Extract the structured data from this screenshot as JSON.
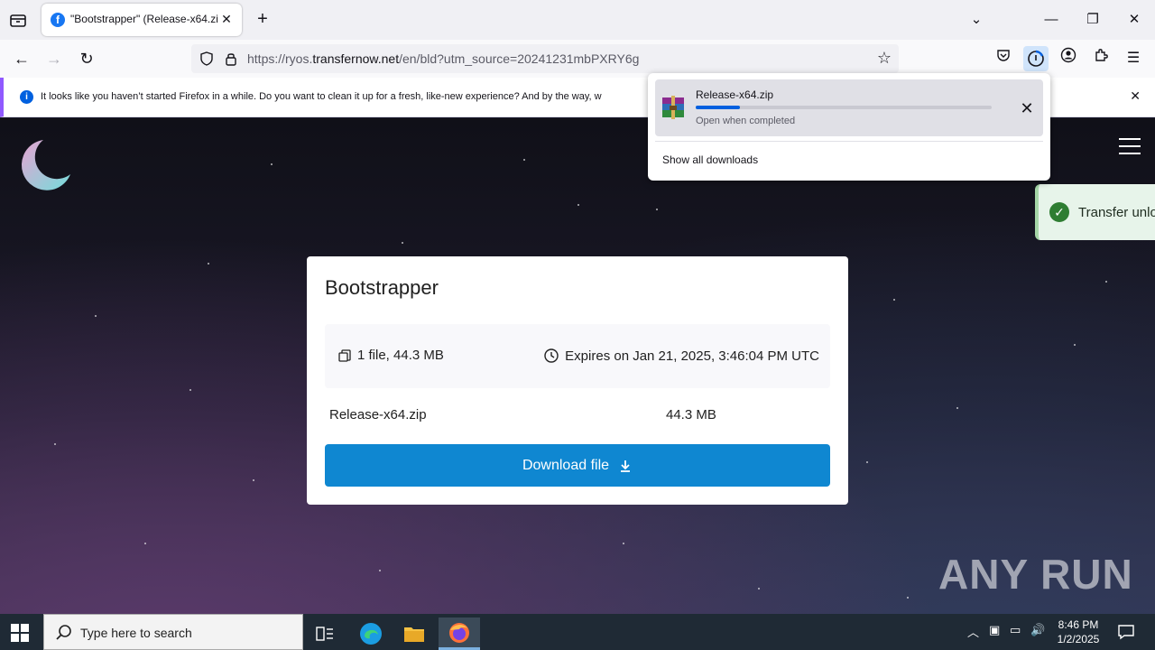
{
  "tab": {
    "title": "\"Bootstrapper\" (Release-x64.zip",
    "favicon": "f"
  },
  "toolbar": {
    "url_prefix": "https://ryos.",
    "url_domain": "transfernow.net",
    "url_path": "/en/bld?utm_source=20241231mbPXRY6g"
  },
  "notification": {
    "message": "It looks like you haven’t started Firefox in a while. Do you want to clean it up for a fresh, like-new experience? And by the way, w"
  },
  "toast": {
    "text": "Transfer unlo"
  },
  "card": {
    "title": "Bootstrapper",
    "files": "1 file, 44.3 MB",
    "expires": "Expires on Jan 21, 2025, 3:46:04 PM UTC",
    "file_name": "Release-x64.zip",
    "file_size": "44.3 MB",
    "download_label": "Download file"
  },
  "downloads": {
    "file_name": "Release-x64.zip",
    "status": "Open when completed",
    "progress": 0.15,
    "show_all": "Show all downloads"
  },
  "watermark": "ANY RUN",
  "taskbar": {
    "search_placeholder": "Type here to search",
    "time": "8:46 PM",
    "date": "1/2/2025"
  },
  "colors": {
    "accent": "#0f87d1",
    "firefox_purple": "#9059ff",
    "progress_blue": "#0060df"
  }
}
